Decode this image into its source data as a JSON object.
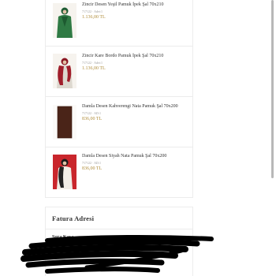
{
  "order_items": [
    {
      "name": "Zincir Desen Yeşil Pamuk İpek Şal 70x210",
      "meta": "717122 · Adet:1",
      "price": "1.136,00 TL"
    },
    {
      "name": "Zincir Kare Bordo Pamuk İpek Şal 70x210",
      "meta": "717122 · Adet:1",
      "price": "1.136,00 TL"
    },
    {
      "name": "Damla Desen Kahverengi Nata Pamuk Şal 70x200",
      "meta": "717122 · AD:1",
      "price": "836,00 TL"
    },
    {
      "name": "Damla Desen Siyah Nata Pamuk Şal 70x200",
      "meta": "717122 · AD:1",
      "price": "836,00 TL"
    }
  ],
  "billing_address": {
    "title": "Fatura Adresi",
    "name": "Şura Kaya"
  },
  "colors": {
    "price": "#b08d3c",
    "border": "#ececec",
    "redaction": "#000000"
  }
}
